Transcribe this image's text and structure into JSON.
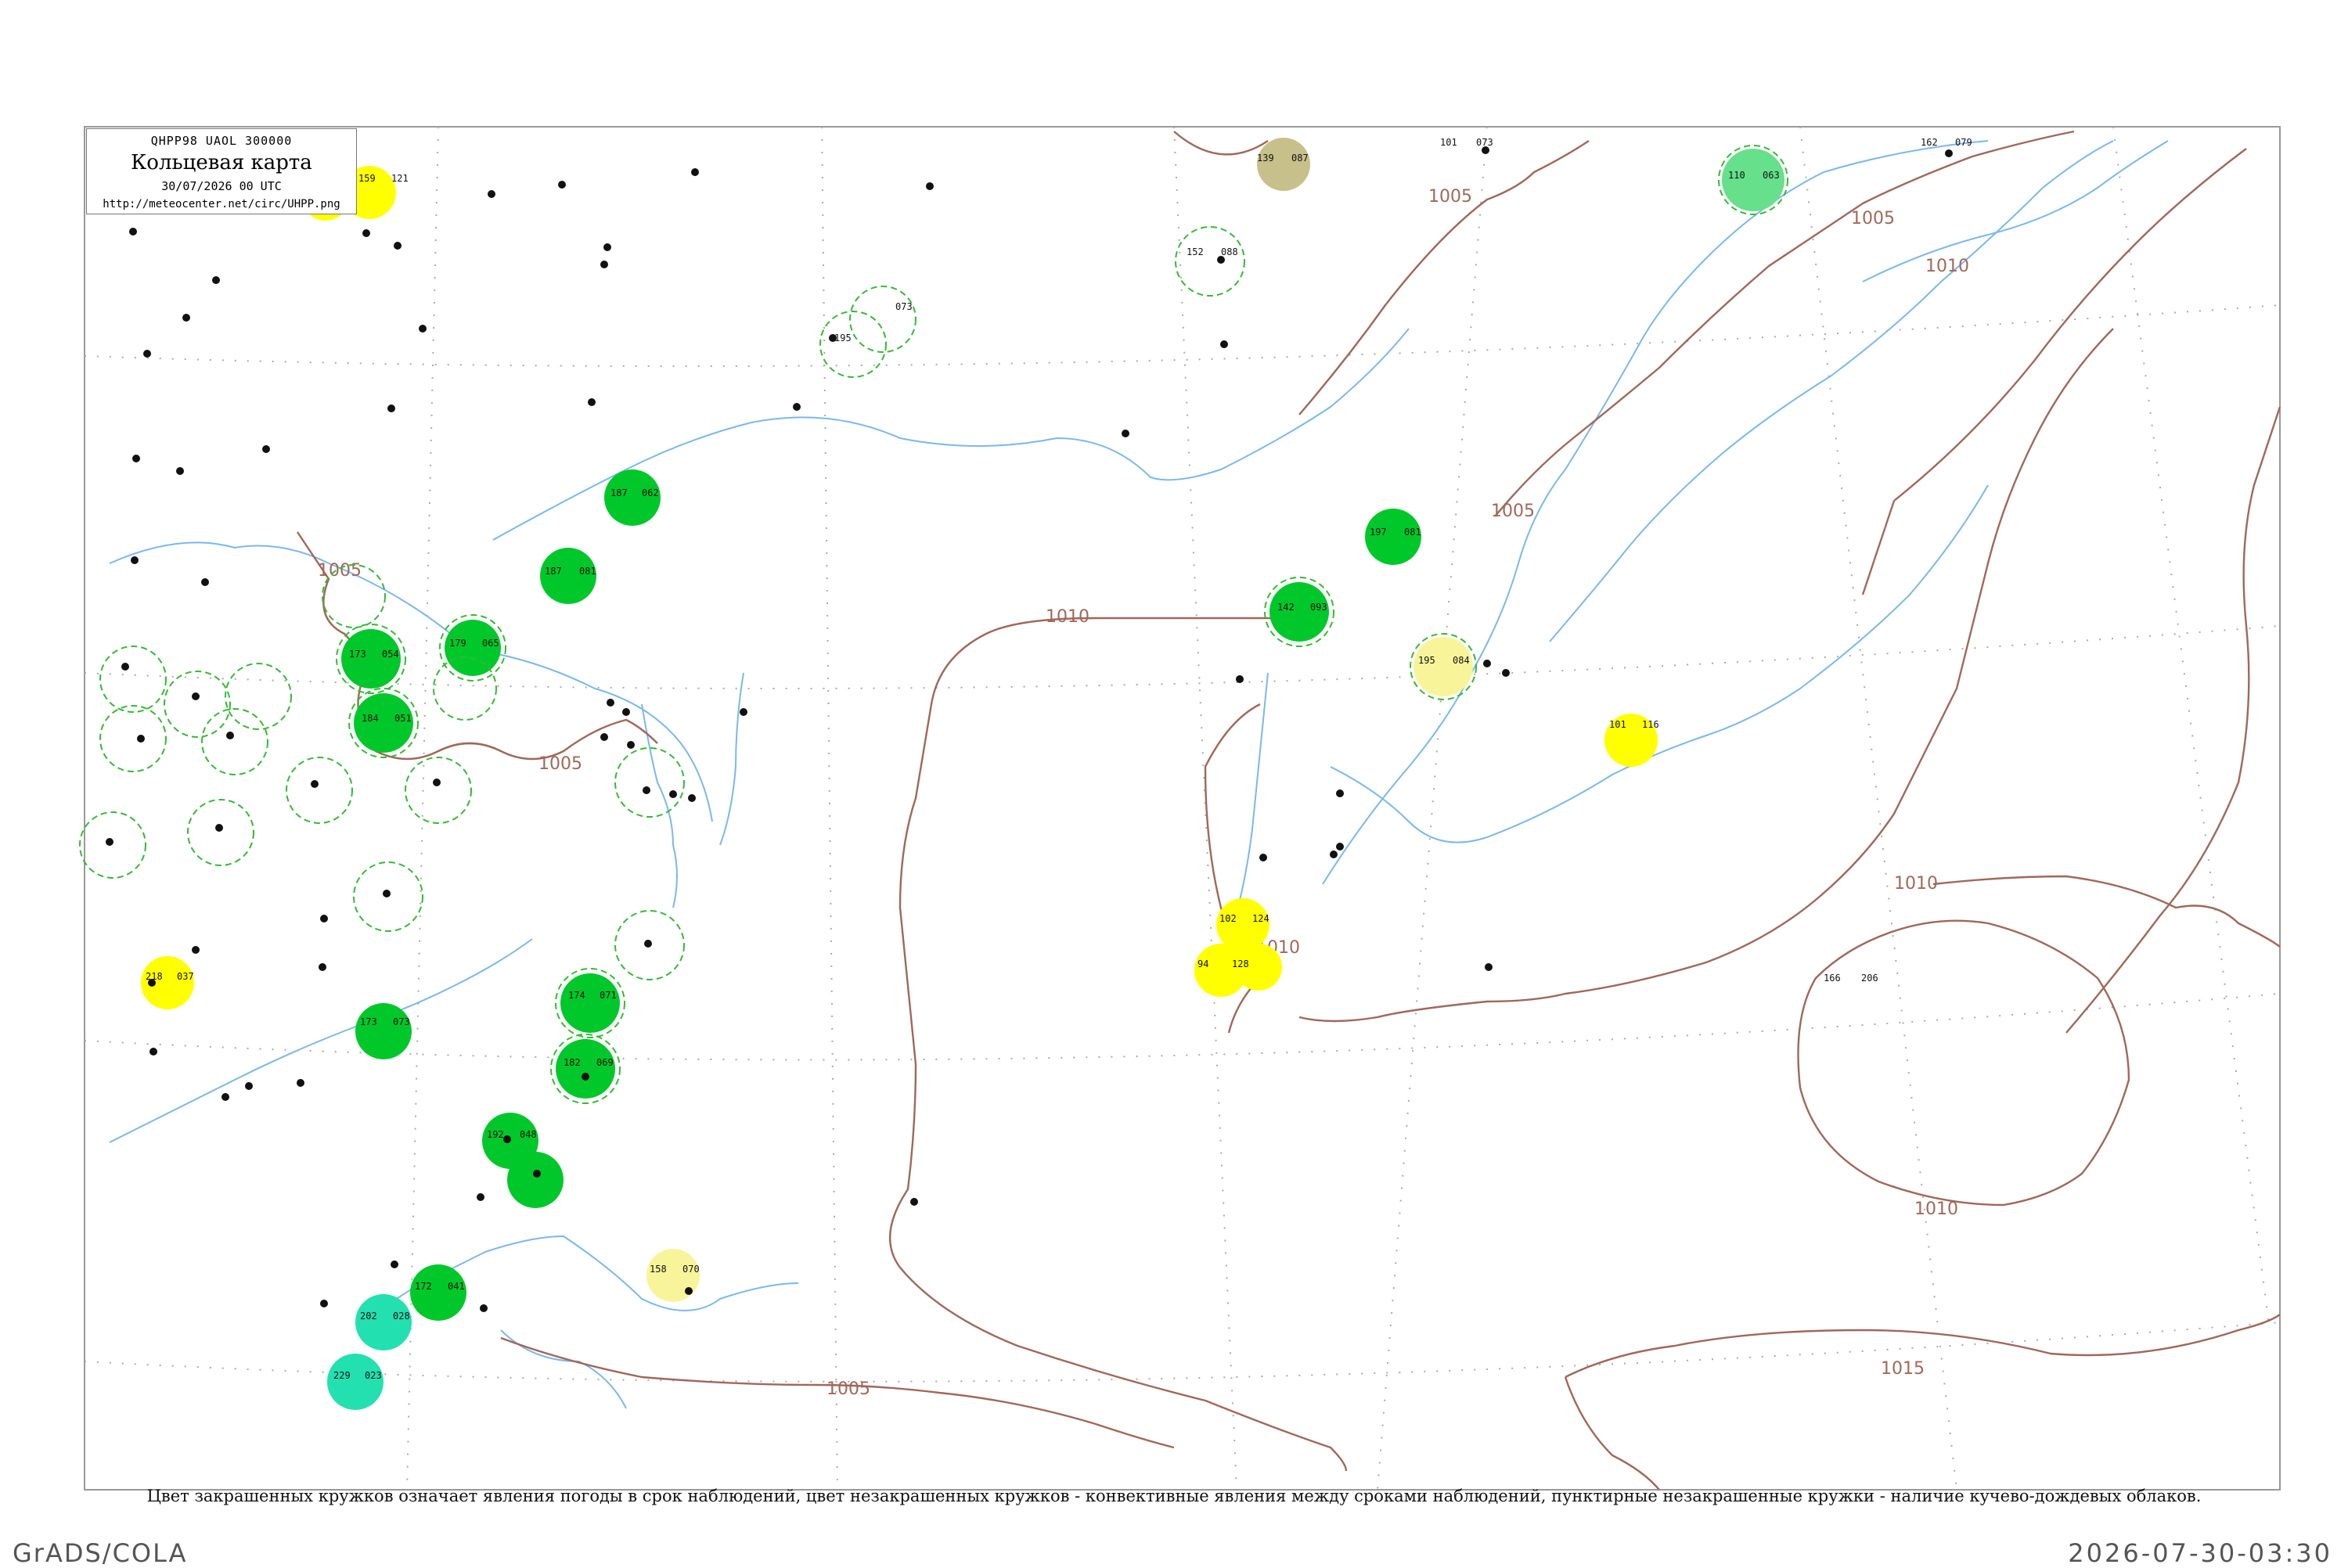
{
  "header": {
    "code_line": "QHPP98  UAOL  300000",
    "title": "Кольцевая карта",
    "datetime": "30/07/2026 00 UTC",
    "url": "http://meteocenter.net/circ/UHPP.png"
  },
  "caption": "Цвет закрашенных кружков означает явления погоды в срок наблюдений, цвет незакрашенных кружков - конвективные явления между сроками наблюдений, пунктирные незакрашенные кружки - наличие кучево-дождевых облаков.",
  "footer": {
    "left": "GrADS/COLA",
    "right": "2026-07-30-03:30"
  },
  "colors": {
    "isobar": "#a0685a",
    "water": "#7ab8ee",
    "frame": "#999999",
    "rain": "#00c82a",
    "cb_ring": "#33bb33",
    "fog_mist": "#ffff00",
    "pale_yellow": "#f8f49a",
    "drizzle_teal": "#22e0b0",
    "light_green": "#66e08a",
    "olive": "#c8c08a"
  },
  "isobar_labels": [
    "1005",
    "1005",
    "1005",
    "1005",
    "1005",
    "1010",
    "1010",
    "1010",
    "1010",
    "1010",
    "1015"
  ],
  "stations": [
    {
      "id": "s1",
      "t": "159",
      "p": "121",
      "tag": "yellow"
    },
    {
      "id": "s2",
      "t": "139",
      "p": "087",
      "tag": "olive"
    },
    {
      "id": "s3",
      "t": "110",
      "p": "063",
      "tag": "lightgreen"
    },
    {
      "id": "s4",
      "t": "195",
      "p": "073",
      "tag": "cb"
    },
    {
      "id": "s5",
      "t": "152",
      "p": "088",
      "tag": "cb"
    },
    {
      "id": "s6",
      "t": "187",
      "p": "062",
      "tag": "rain"
    },
    {
      "id": "s7",
      "t": "197",
      "p": "081",
      "tag": "rain"
    },
    {
      "id": "s8",
      "t": "187",
      "p": "081",
      "tag": "rain"
    },
    {
      "id": "s9",
      "t": "142",
      "p": "093",
      "tag": "rain"
    },
    {
      "id": "s10",
      "t": "195",
      "p": "084",
      "tag": "paleyellow"
    },
    {
      "id": "s11",
      "t": "101",
      "p": "116",
      "tag": "yellow"
    },
    {
      "id": "s12",
      "t": "102",
      "p": "124",
      "tag": "yellow"
    },
    {
      "id": "s13",
      "t": "94",
      "p": "128",
      "tag": "yellow"
    },
    {
      "id": "s14",
      "t": "218",
      "p": "037",
      "tag": "yellow"
    },
    {
      "id": "s15",
      "t": "173",
      "p": "073",
      "tag": "rain"
    },
    {
      "id": "s16",
      "t": "174",
      "p": "071",
      "tag": "rain"
    },
    {
      "id": "s17",
      "t": "182",
      "p": "069",
      "tag": "rain"
    },
    {
      "id": "s18",
      "t": "173",
      "p": "054",
      "tag": "rain"
    },
    {
      "id": "s19",
      "t": "184",
      "p": "051",
      "tag": "rain"
    },
    {
      "id": "s20",
      "t": "179",
      "p": "065",
      "tag": "rain"
    },
    {
      "id": "s21",
      "t": "192",
      "p": "048",
      "tag": "rain"
    },
    {
      "id": "s22",
      "t": "172",
      "p": "041",
      "tag": "rain"
    },
    {
      "id": "s23",
      "t": "202",
      "p": "028",
      "tag": "teal"
    },
    {
      "id": "s24",
      "t": "229",
      "p": "023",
      "tag": "teal"
    },
    {
      "id": "s25",
      "t": "158",
      "p": "070",
      "tag": "paleyellow"
    },
    {
      "id": "s26",
      "t": "166",
      "p": "206",
      "tag": "none"
    },
    {
      "id": "s27",
      "t": "101",
      "p": "073",
      "tag": "none"
    },
    {
      "id": "s28",
      "t": "162",
      "p": "079",
      "tag": "none"
    }
  ]
}
